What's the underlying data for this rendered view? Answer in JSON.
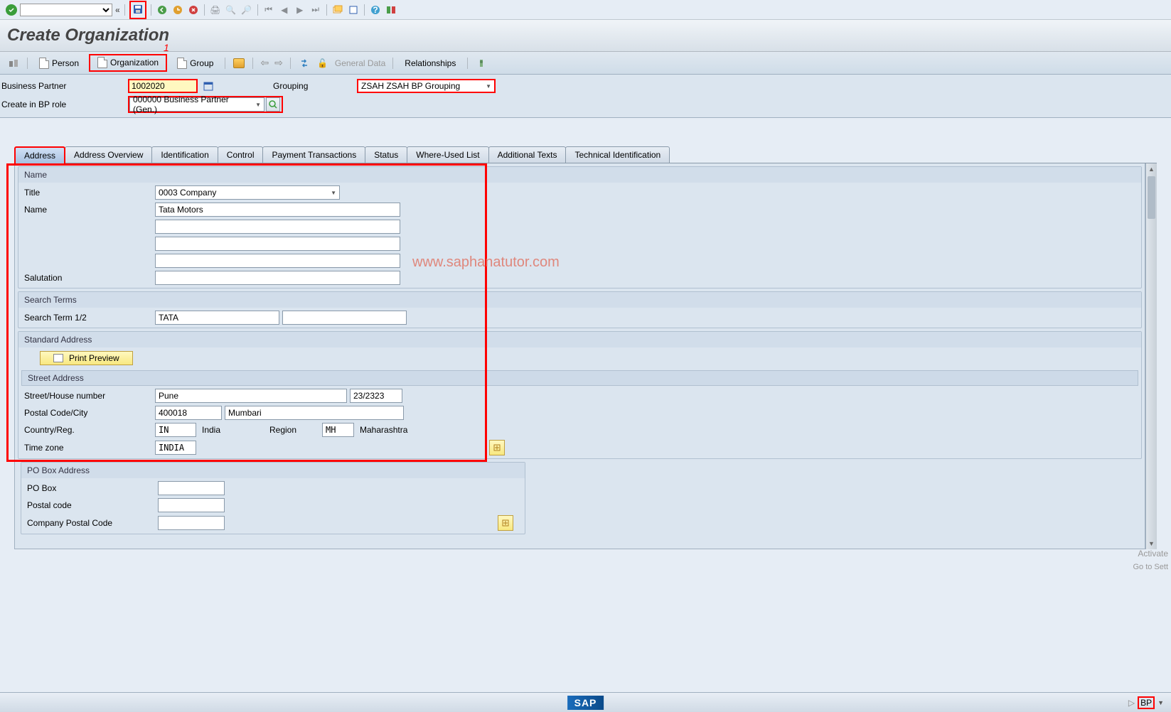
{
  "page_title": "Create Organization",
  "annotation_number": "1",
  "watermark": "www.saphanatutor.com",
  "activate_text": "Activate",
  "activate_sub": "Go to Sett",
  "sub_toolbar": {
    "person": "Person",
    "organization": "Organization",
    "group": "Group",
    "general_data": "General Data",
    "relationships": "Relationships"
  },
  "header": {
    "bp_label": "Business Partner",
    "bp_value": "1002020",
    "grouping_label": "Grouping",
    "grouping_value": "ZSAH ZSAH BP Grouping",
    "role_label": "Create in BP role",
    "role_value": "000000 Business Partner (Gen.)"
  },
  "tabs": {
    "address": "Address",
    "address_overview": "Address Overview",
    "identification": "Identification",
    "control": "Control",
    "payment": "Payment Transactions",
    "status": "Status",
    "where_used": "Where-Used List",
    "additional": "Additional Texts",
    "technical": "Technical Identification"
  },
  "name_section": {
    "title": "Name",
    "title_label": "Title",
    "title_value": "0003 Company",
    "name_label": "Name",
    "name_value": "Tata Motors",
    "salutation_label": "Salutation"
  },
  "search_section": {
    "title": "Search Terms",
    "term_label": "Search Term 1/2",
    "term_value": "TATA"
  },
  "address_section": {
    "title": "Standard Address",
    "print_preview": "Print Preview",
    "street_title": "Street Address",
    "street_label": "Street/House number",
    "street_value": "Pune",
    "house_value": "23/2323",
    "postal_label": "Postal Code/City",
    "postal_value": "400018",
    "city_value": "Mumbari",
    "country_label": "Country/Reg.",
    "country_value": "IN",
    "country_text": "India",
    "region_label": "Region",
    "region_value": "MH",
    "region_text": "Maharashtra",
    "tz_label": "Time zone",
    "tz_value": "INDIA"
  },
  "pobox_section": {
    "title": "PO Box Address",
    "pobox_label": "PO Box",
    "postal_label": "Postal code",
    "company_postal_label": "Company Postal Code"
  },
  "footer": {
    "bp_indicator": "BP"
  }
}
